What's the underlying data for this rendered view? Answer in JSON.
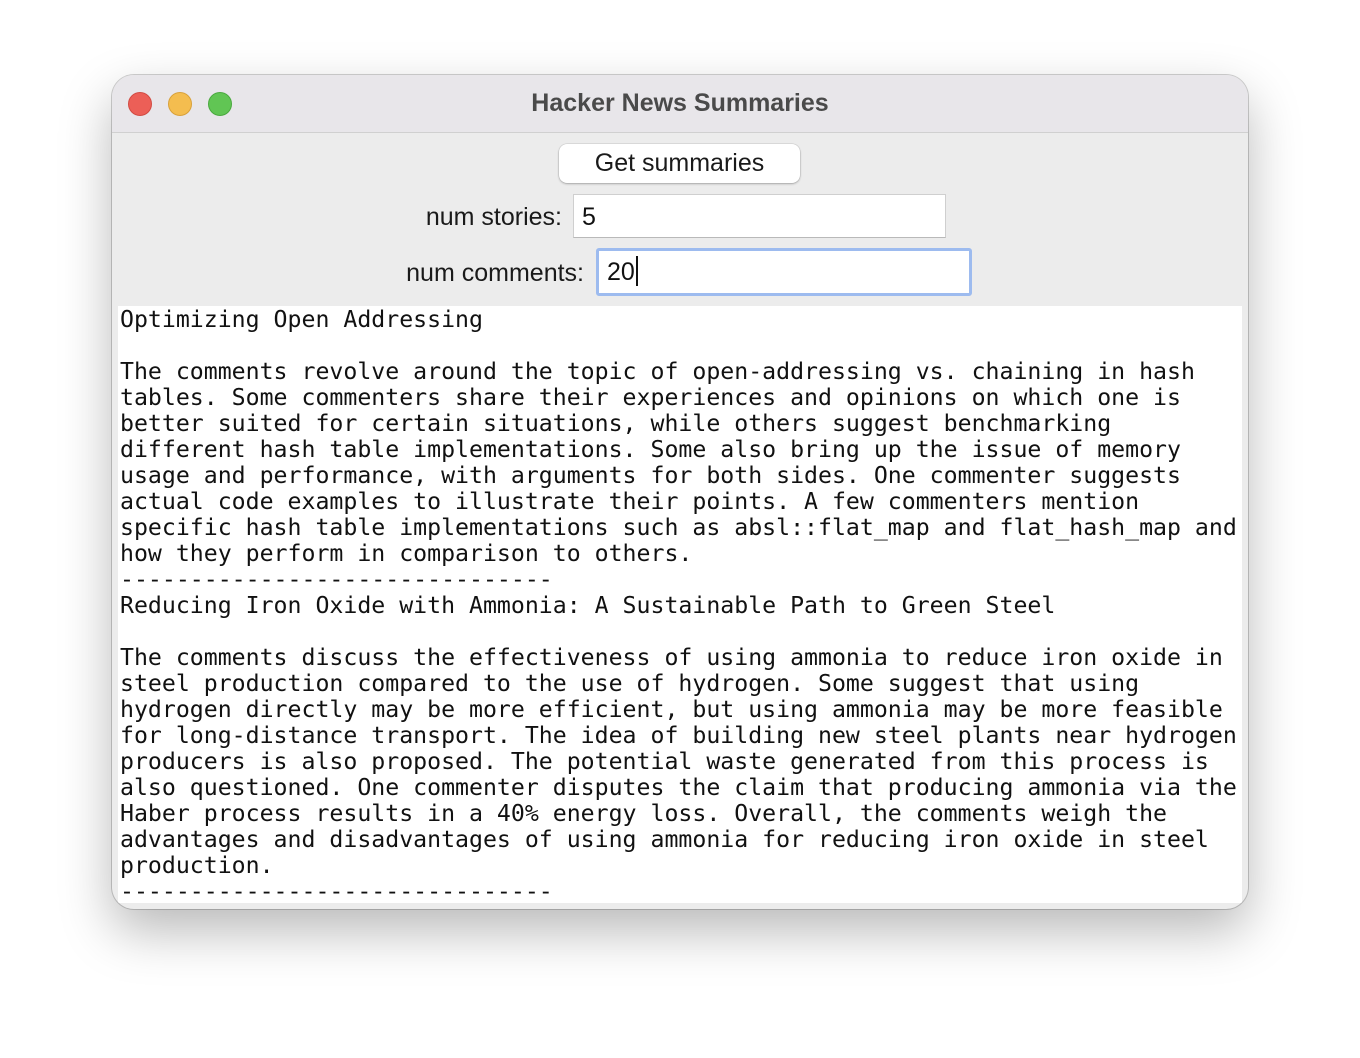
{
  "window": {
    "title": "Hacker News Summaries"
  },
  "controls": {
    "get_button_label": "Get summaries",
    "num_stories_label": "num stories:",
    "num_stories_value": "5",
    "num_comments_label": "num comments:",
    "num_comments_value": "20"
  },
  "output": {
    "text": "Optimizing Open Addressing\n\nThe comments revolve around the topic of open-addressing vs. chaining in hash\ntables. Some commenters share their experiences and opinions on which one is\nbetter suited for certain situations, while others suggest benchmarking\ndifferent hash table implementations. Some also bring up the issue of memory\nusage and performance, with arguments for both sides. One commenter suggests\nactual code examples to illustrate their points. A few commenters mention\nspecific hash table implementations such as absl::flat_map and flat_hash_map and\nhow they perform in comparison to others.\n-------------------------------\nReducing Iron Oxide with Ammonia: A Sustainable Path to Green Steel\n\nThe comments discuss the effectiveness of using ammonia to reduce iron oxide in\nsteel production compared to the use of hydrogen. Some suggest that using\nhydrogen directly may be more efficient, but using ammonia may be more feasible\nfor long-distance transport. The idea of building new steel plants near hydrogen\nproducers is also proposed. The potential waste generated from this process is\nalso questioned. One commenter disputes the claim that producing ammonia via the\nHaber process results in a 40% energy loss. Overall, the comments weigh the\nadvantages and disadvantages of using ammonia for reducing iron oxide in steel\nproduction.\n-------------------------------"
  }
}
